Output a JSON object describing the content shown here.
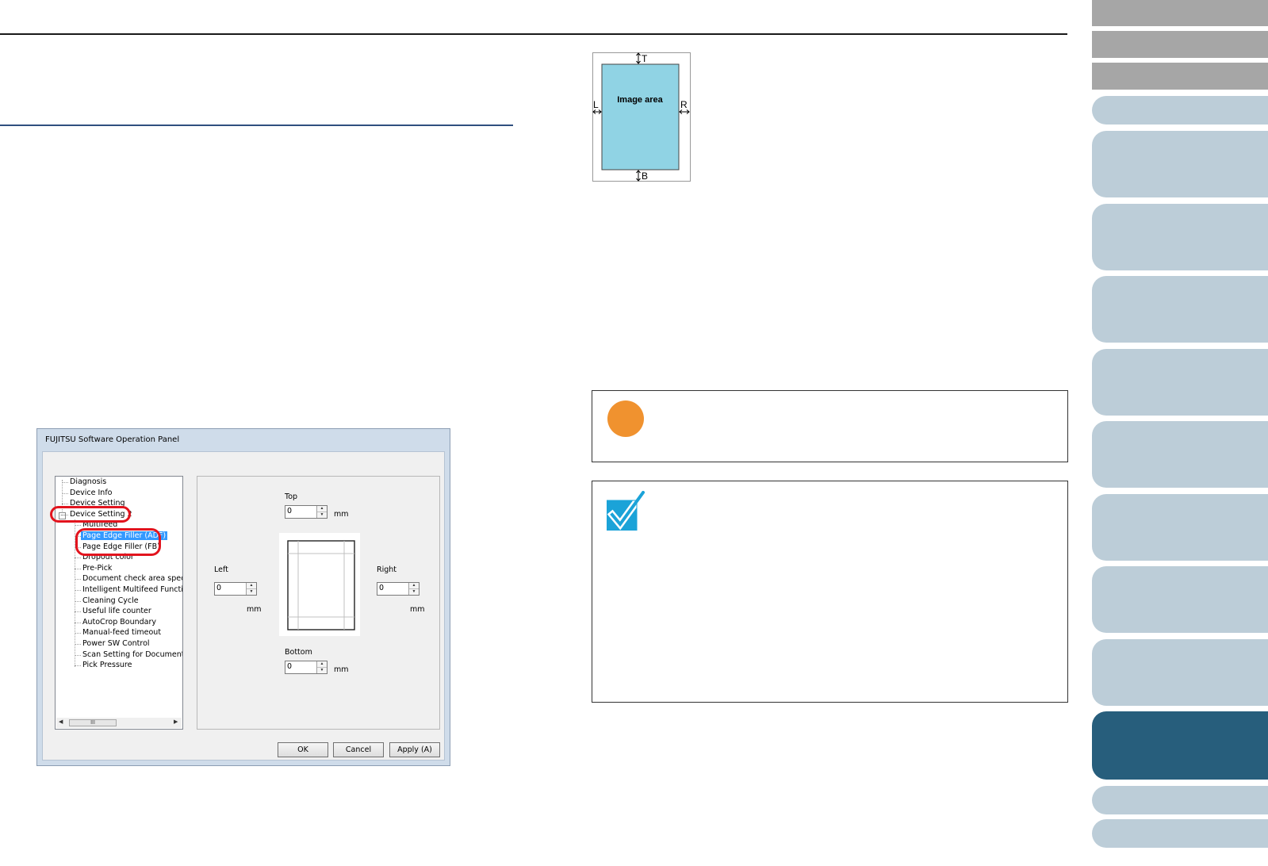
{
  "dialog": {
    "title": "FUJITSU Software Operation Panel",
    "tree": [
      {
        "label": "Diagnosis",
        "level": 0,
        "selected": false
      },
      {
        "label": "Device Info",
        "level": 0,
        "selected": false
      },
      {
        "label": "Device Setting",
        "level": 0,
        "selected": false
      },
      {
        "label": "Device Setting 2",
        "level": 0,
        "selected": false,
        "expanded": true
      },
      {
        "label": "Multifeed",
        "level": 1,
        "selected": false
      },
      {
        "label": "Page Edge Filler (ADF)",
        "level": 1,
        "selected": true
      },
      {
        "label": "Page Edge Filler (FB)",
        "level": 1,
        "selected": false
      },
      {
        "label": "Dropout color",
        "level": 1,
        "selected": false
      },
      {
        "label": "Pre-Pick",
        "level": 1,
        "selected": false
      },
      {
        "label": "Document check area specific",
        "level": 1,
        "selected": false
      },
      {
        "label": "Intelligent Multifeed Function",
        "level": 1,
        "selected": false
      },
      {
        "label": "Cleaning Cycle",
        "level": 1,
        "selected": false
      },
      {
        "label": "Useful life counter",
        "level": 1,
        "selected": false
      },
      {
        "label": "AutoCrop Boundary",
        "level": 1,
        "selected": false
      },
      {
        "label": "Manual-feed timeout",
        "level": 1,
        "selected": false
      },
      {
        "label": "Power SW Control",
        "level": 1,
        "selected": false
      },
      {
        "label": "Scan Setting for Document wit",
        "level": 1,
        "selected": false
      },
      {
        "label": "Pick Pressure",
        "level": 1,
        "selected": false
      }
    ],
    "expander_glyph": "−",
    "scroll_thumb_glyph": "III",
    "scroll_left_glyph": "◀",
    "scroll_right_glyph": "▶",
    "fields": {
      "top": {
        "label": "Top",
        "value": "0",
        "unit": "mm"
      },
      "left": {
        "label": "Left",
        "value": "0",
        "unit": "mm"
      },
      "right": {
        "label": "Right",
        "value": "0",
        "unit": "mm"
      },
      "bottom": {
        "label": "Bottom",
        "value": "0",
        "unit": "mm"
      }
    },
    "buttons": {
      "ok": "OK",
      "cancel": "Cancel",
      "apply": "Apply (A)"
    }
  },
  "diagram": {
    "area_label": "Image area",
    "top_letter": "T",
    "bottom_letter": "B",
    "left_letter": "L",
    "right_letter": "R",
    "area_color": "#90d3e4"
  },
  "colors": {
    "attention": "#f0922f",
    "hint": "#1ba3d8",
    "nav_gray": "#a6a6a6",
    "nav_light": "#bccdd8",
    "nav_active": "#275e7c",
    "highlight": "#e2141e"
  },
  "icons": {
    "attention": "attention-circle-icon",
    "hint": "checkmark-icon"
  }
}
